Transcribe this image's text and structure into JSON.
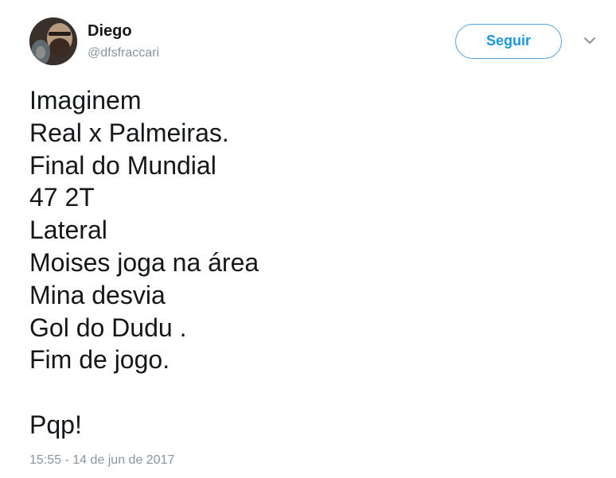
{
  "author": {
    "name": "Diego",
    "handle": "@dfsfraccari",
    "avatar_icon": "user-avatar-photo"
  },
  "follow_button": {
    "label": "Seguir",
    "color": "#1b95e0"
  },
  "menu": {
    "icon": "chevron-down-icon"
  },
  "tweet": {
    "lines": [
      "Imaginem",
      "Real x Palmeiras.",
      "Final do Mundial",
      "47 2T",
      "Lateral",
      "Moises joga na área",
      "Mina desvia",
      "Gol do Dudu .",
      "Fim de jogo.",
      "",
      "Pqp!"
    ]
  },
  "timestamp": "15:55 - 14 de jun de 2017"
}
